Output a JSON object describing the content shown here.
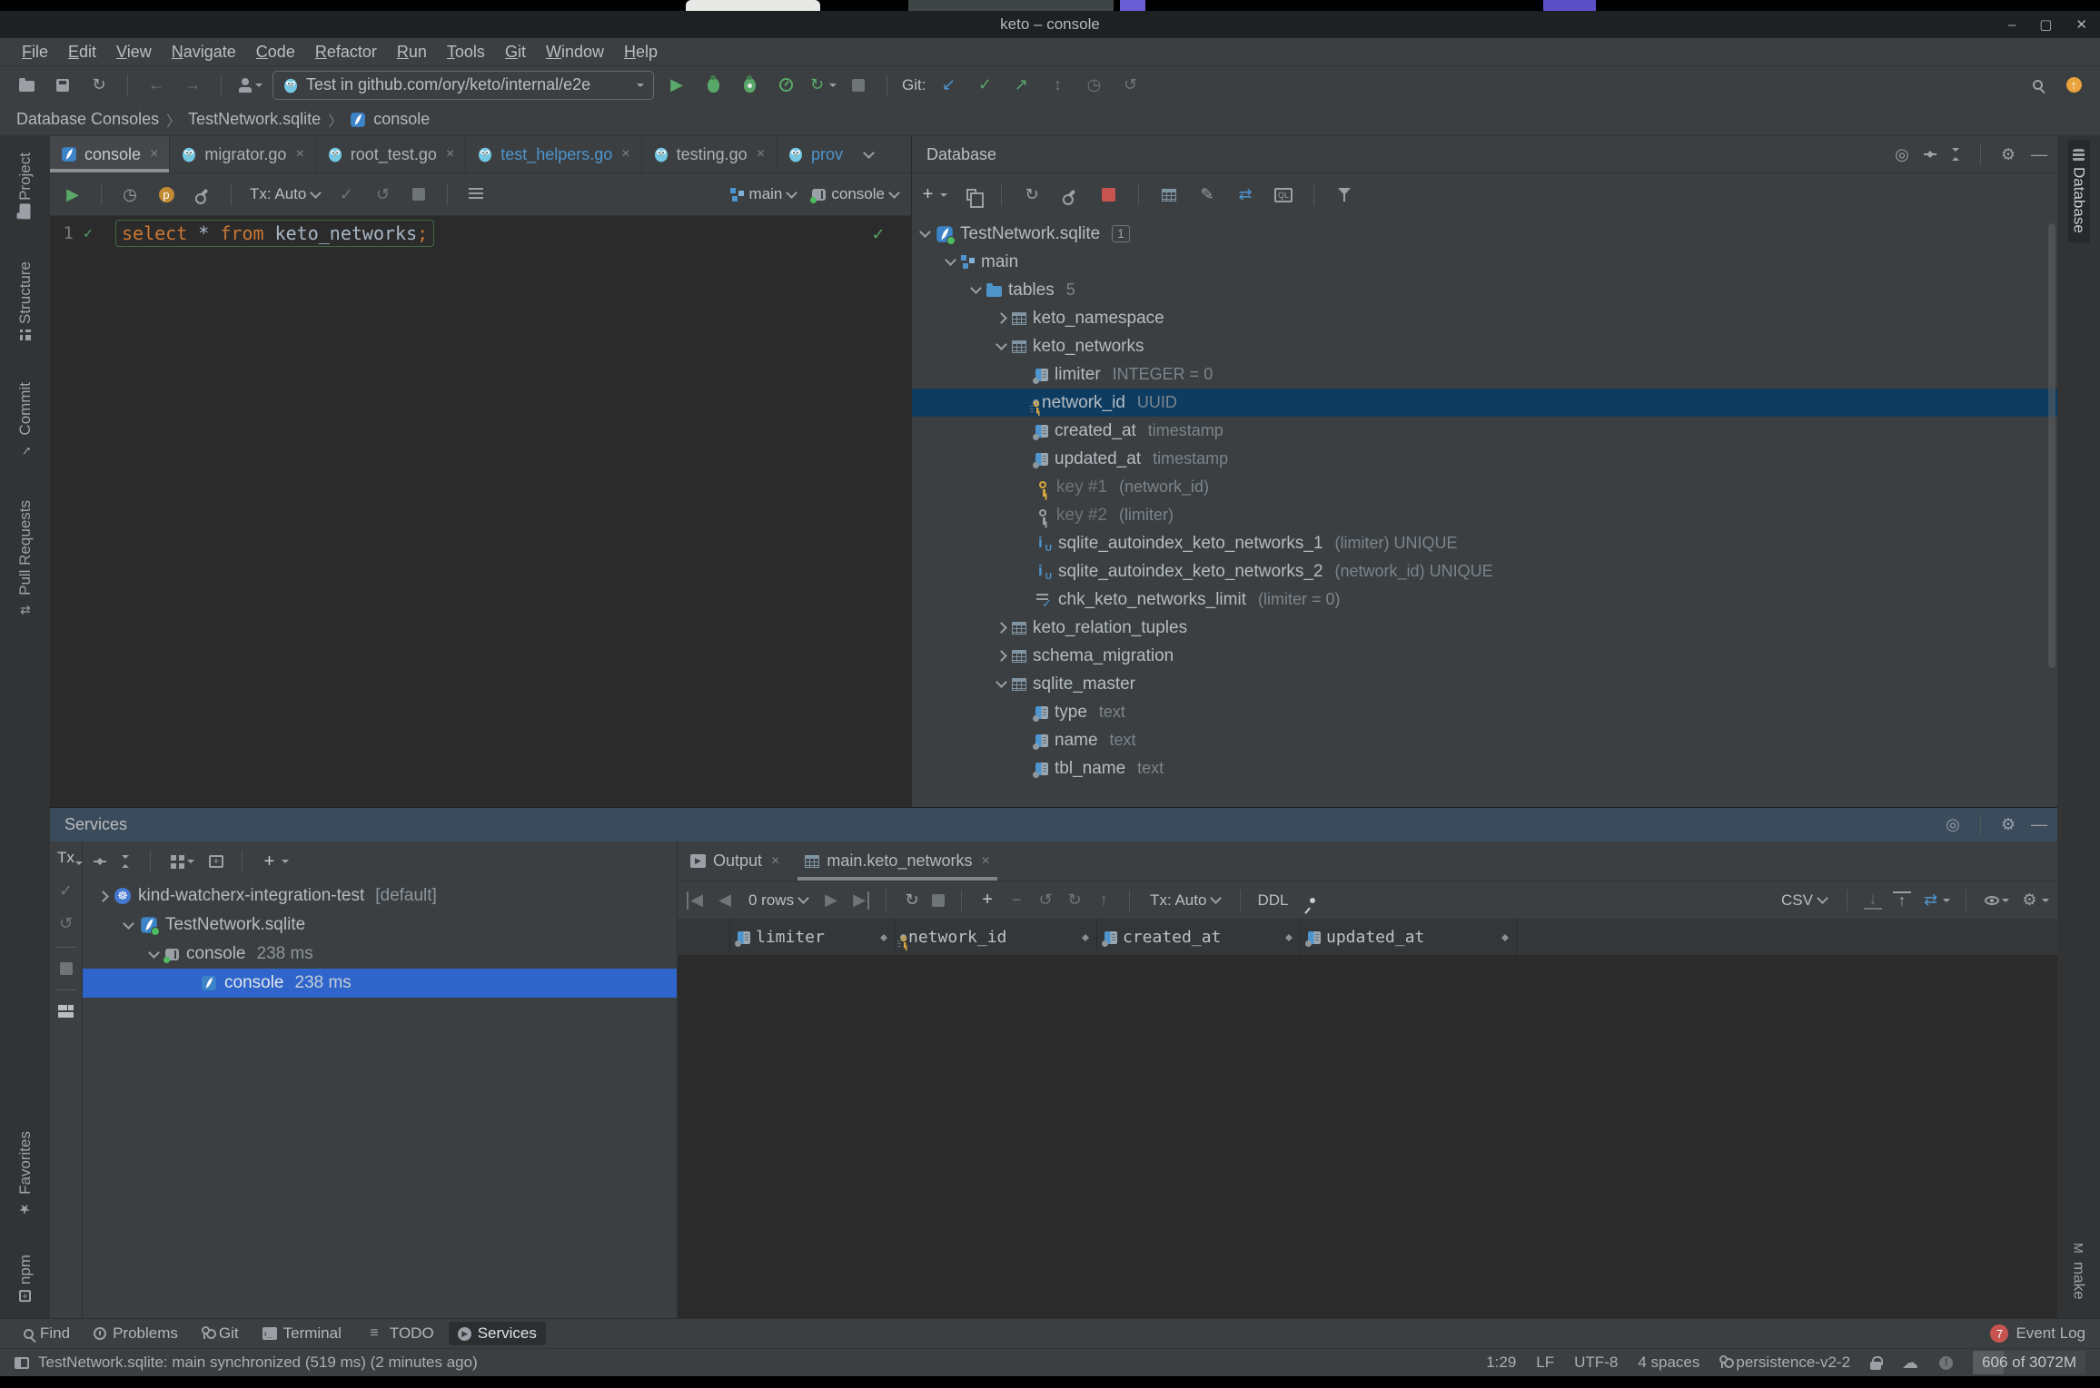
{
  "window": {
    "title": "keto – console"
  },
  "top_menu": {
    "items": [
      "File",
      "Edit",
      "View",
      "Navigate",
      "Code",
      "Refactor",
      "Run",
      "Tools",
      "Git",
      "Window",
      "Help"
    ]
  },
  "toolbar": {
    "run_config": "Test in github.com/ory/keto/internal/e2e",
    "git_label": "Git:"
  },
  "breadcrumbs": {
    "items": [
      "Database Consoles",
      "TestNetwork.sqlite",
      "console"
    ]
  },
  "left_strip": {
    "top": [
      "Project",
      "Structure",
      "Commit",
      "Pull Requests"
    ],
    "bottom": [
      "Favorites",
      "npm"
    ]
  },
  "right_strip": {
    "top": "Database",
    "bottom": "make"
  },
  "editor": {
    "tabs": [
      {
        "label": "console"
      },
      {
        "label": "migrator.go"
      },
      {
        "label": "root_test.go"
      },
      {
        "label": "test_helpers.go"
      },
      {
        "label": "testing.go"
      },
      {
        "label": "prov"
      }
    ],
    "toolbar": {
      "tx": "Tx: Auto",
      "schema": "main",
      "session": "console"
    },
    "sql": {
      "line_number": "1",
      "keyword1": "select",
      "operator": " * ",
      "keyword2": "from",
      "identifier": " keto_networks",
      "terminator": ";"
    }
  },
  "database": {
    "title": "Database",
    "tree": [
      {
        "label": "TestNetwork.sqlite",
        "badge": "1"
      },
      {
        "label": "main"
      },
      {
        "label": "tables",
        "meta": "5"
      },
      {
        "label": "keto_namespace"
      },
      {
        "label": "keto_networks"
      },
      {
        "label": "limiter",
        "meta": "INTEGER = 0"
      },
      {
        "label": "network_id",
        "meta": "UUID"
      },
      {
        "label": "created_at",
        "meta": "timestamp"
      },
      {
        "label": "updated_at",
        "meta": "timestamp"
      },
      {
        "label": "key #1",
        "meta": "(network_id)"
      },
      {
        "label": "key #2",
        "meta": "(limiter)"
      },
      {
        "label": "sqlite_autoindex_keto_networks_1",
        "meta": "(limiter) UNIQUE"
      },
      {
        "label": "sqlite_autoindex_keto_networks_2",
        "meta": "(network_id) UNIQUE"
      },
      {
        "label": "chk_keto_networks_limit",
        "meta": "(limiter = 0)"
      },
      {
        "label": "keto_relation_tuples"
      },
      {
        "label": "schema_migration"
      },
      {
        "label": "sqlite_master"
      },
      {
        "label": "type",
        "meta": "text"
      },
      {
        "label": "name",
        "meta": "text"
      },
      {
        "label": "tbl_name",
        "meta": "text"
      }
    ]
  },
  "services": {
    "title": "Services",
    "tx_label": "Tx",
    "tree": [
      {
        "label": "kind-watcherx-integration-test",
        "meta": "[default]"
      },
      {
        "label": "TestNetwork.sqlite",
        "meta": ""
      },
      {
        "label": "console",
        "meta": "238 ms"
      },
      {
        "label": "console",
        "meta": "238 ms"
      }
    ],
    "tabs": [
      {
        "label": "Output"
      },
      {
        "label": "main.keto_networks"
      }
    ],
    "grid": {
      "rows_count": "0 rows",
      "tx": "Tx: Auto",
      "ddl": "DDL",
      "csv": "CSV",
      "columns": [
        {
          "label": "limiter"
        },
        {
          "label": "network_id"
        },
        {
          "label": "created_at"
        },
        {
          "label": "updated_at"
        }
      ]
    }
  },
  "bottom_bar": {
    "items": [
      "Find",
      "Problems",
      "Git",
      "Terminal",
      "TODO",
      "Services"
    ],
    "event_log": {
      "badge": "7",
      "label": "Event Log"
    }
  },
  "status_bar": {
    "message": "TestNetwork.sqlite: main synchronized (519 ms) (2 minutes ago)",
    "position": "1:29",
    "line_ending": "LF",
    "encoding": "UTF-8",
    "indent": "4 spaces",
    "branch": "persistence-v2-2",
    "memory": "606 of 3072M"
  },
  "colors": {
    "accent_blue": "#4e94ce",
    "selection_blue": "#2f65ca",
    "tree_selection": "#0e3c61",
    "green": "#59a869",
    "keyword_orange": "#cc7832",
    "red": "#c75450",
    "gold_key": "#d7a53f"
  }
}
